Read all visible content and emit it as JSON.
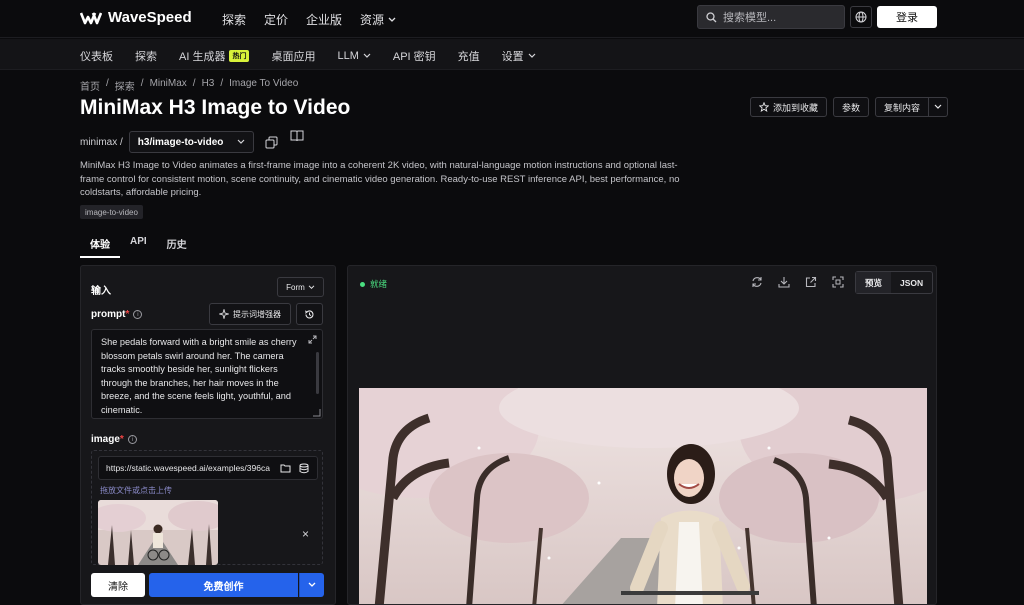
{
  "brand": {
    "name": "WaveSpeed"
  },
  "topnav": [
    {
      "label": "探索"
    },
    {
      "label": "定价"
    },
    {
      "label": "企业版"
    },
    {
      "label": "资源"
    }
  ],
  "search": {
    "placeholder": "搜索模型..."
  },
  "login_label": "登录",
  "subnav": [
    {
      "label": "仪表板"
    },
    {
      "label": "探索"
    },
    {
      "label": "AI 生成器",
      "badge": "热门"
    },
    {
      "label": "桌面应用"
    },
    {
      "label": "LLM"
    },
    {
      "label": "API 密钥"
    },
    {
      "label": "充值"
    },
    {
      "label": "设置"
    }
  ],
  "breadcrumb": [
    "首页",
    "探索",
    "MiniMax",
    "H3",
    "Image To Video"
  ],
  "breadcrumb_sep": "/",
  "page": {
    "title": "MiniMax H3 Image to Video",
    "favorite_label": "添加到收藏",
    "params_label": "参数",
    "copy_label": "复制内容",
    "owner": "minimax /",
    "model_id": "h3/image-to-video",
    "description": "MiniMax H3 Image to Video animates a first-frame image into a coherent 2K video, with natural-language motion instructions and optional last-frame control for consistent motion, scene continuity, and cinematic video generation. Ready-to-use REST inference API, best performance, no coldstarts, affordable pricing.",
    "tag": "image-to-video"
  },
  "tabs": [
    {
      "label": "体验",
      "active": true
    },
    {
      "label": "API",
      "active": false
    },
    {
      "label": "历史",
      "active": false
    }
  ],
  "input_panel": {
    "heading": "输入",
    "mode": "Form",
    "prompt_label": "prompt",
    "required_mark": "*",
    "info_glyph": "i",
    "enhancer_label": "提示词增强器",
    "prompt_value": "She pedals forward with a bright smile as cherry blossom petals swirl around her. The camera tracks smoothly beside her, sunlight flickers through the branches, her hair moves in the breeze, and the scene feels light, youthful, and cinematic.",
    "image_label": "image",
    "image_url": "https://static.wavespeed.ai/examples/396ca",
    "drop_hint": "拖放文件或点击上传",
    "remove_glyph": "×",
    "clear_label": "清除",
    "create_label": "免费创作"
  },
  "output_panel": {
    "status": "就绪",
    "view_preview": "预览",
    "view_json": "JSON",
    "icons": [
      "refresh-icon",
      "download-icon",
      "open-external-icon",
      "fullscreen-icon"
    ]
  },
  "colors": {
    "accent_blue": "#2563eb",
    "ready_green": "#4ade80",
    "hot_badge": "#d8f23a",
    "required_red": "#ef4444"
  }
}
